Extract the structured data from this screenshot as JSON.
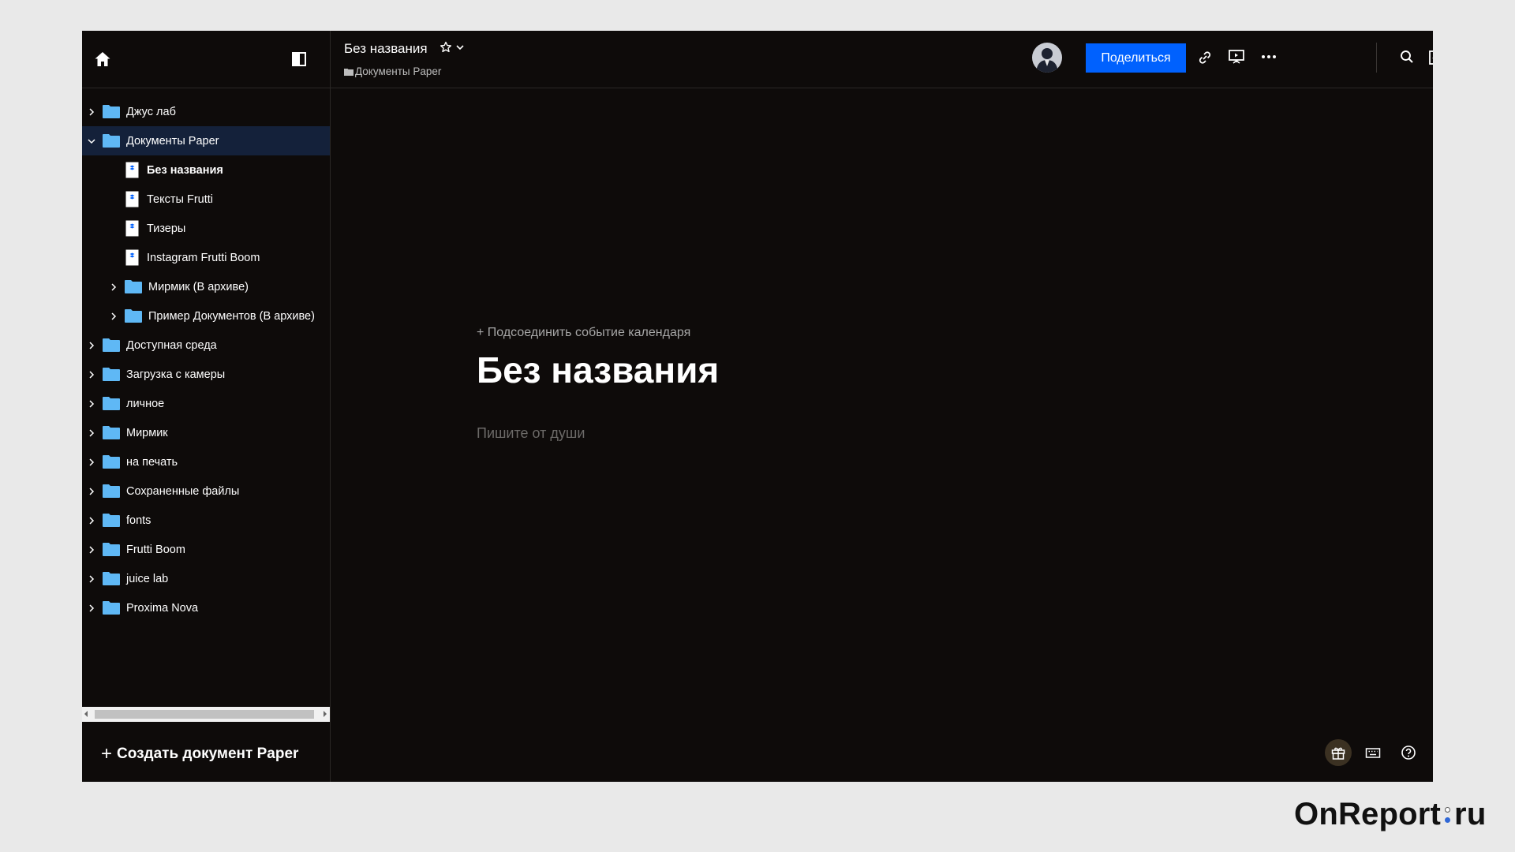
{
  "header": {
    "doc_title": "Без названия",
    "breadcrumb": "Документы Paper",
    "share_label": "Поделиться"
  },
  "sidebar": {
    "items": [
      {
        "label": "Джус лаб",
        "type": "folder",
        "level": 0,
        "expanded": false,
        "selected": false
      },
      {
        "label": "Документы Paper",
        "type": "folder",
        "level": 0,
        "expanded": true,
        "selected": true
      },
      {
        "label": "Без названия",
        "type": "doc",
        "level": 1,
        "active": true
      },
      {
        "label": "Тексты Frutti",
        "type": "doc",
        "level": 1
      },
      {
        "label": "Тизеры",
        "type": "doc",
        "level": 1
      },
      {
        "label": "Instagram Frutti Boom",
        "type": "doc",
        "level": 1
      },
      {
        "label": "Мирмик (В архиве)",
        "type": "folder",
        "level": 1,
        "expanded": false
      },
      {
        "label": "Пример Документов (В архиве)",
        "type": "folder",
        "level": 1,
        "expanded": false
      },
      {
        "label": "Доступная среда",
        "type": "folder",
        "level": 0,
        "expanded": false
      },
      {
        "label": "Загрузка с камеры",
        "type": "folder",
        "level": 0,
        "expanded": false
      },
      {
        "label": "личное",
        "type": "folder",
        "level": 0,
        "expanded": false
      },
      {
        "label": "Мирмик",
        "type": "folder",
        "level": 0,
        "expanded": false
      },
      {
        "label": "на печать",
        "type": "folder",
        "level": 0,
        "expanded": false
      },
      {
        "label": "Сохраненные файлы",
        "type": "folder",
        "level": 0,
        "expanded": false
      },
      {
        "label": "fonts",
        "type": "folder",
        "level": 0,
        "expanded": false
      },
      {
        "label": "Frutti Boom",
        "type": "folder",
        "level": 0,
        "expanded": false
      },
      {
        "label": "juice lab",
        "type": "folder",
        "level": 0,
        "expanded": false
      },
      {
        "label": "Proxima Nova",
        "type": "folder",
        "level": 0,
        "expanded": false
      }
    ],
    "create_label": "Создать документ Paper"
  },
  "editor": {
    "calendar_link": "+ Подсоединить событие календаря",
    "title": "Без названия",
    "placeholder": "Пишите от души"
  },
  "watermark": {
    "part1": "OnReport",
    "part2": "ru"
  },
  "colors": {
    "accent": "#0061fe",
    "folder": "#5fb8f5",
    "background": "#0e0b0a",
    "selected_row": "#14213a"
  },
  "icons": [
    "home-icon",
    "sidebar-toggle-icon",
    "star-icon",
    "chevron-down-icon",
    "link-icon",
    "present-icon",
    "more-icon",
    "search-icon",
    "checklist-icon",
    "bell-icon",
    "plus-icon",
    "gift-icon",
    "keyboard-icon",
    "help-icon"
  ]
}
